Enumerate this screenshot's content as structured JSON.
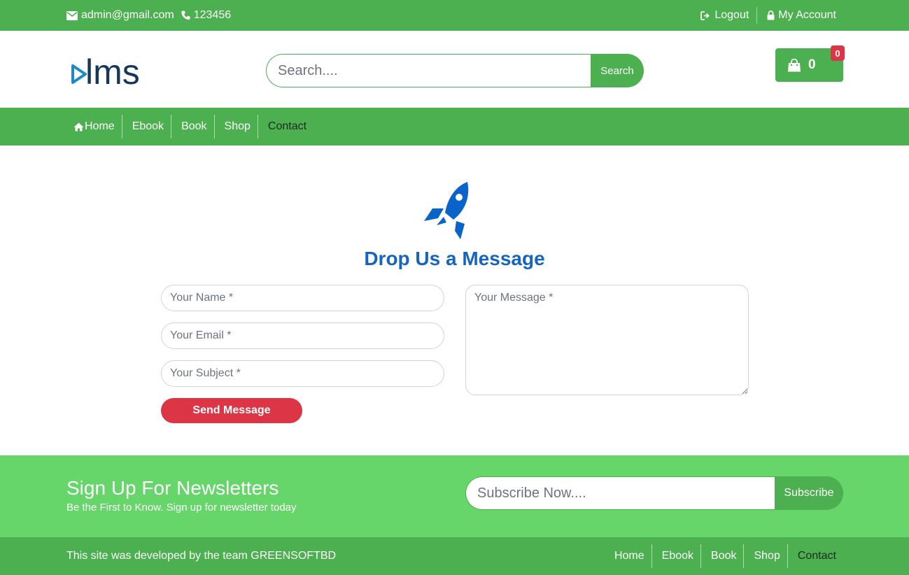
{
  "topbar": {
    "email": "admin@gmail.com",
    "phone": "123456",
    "logout": "Logout",
    "account": "My Account"
  },
  "header": {
    "logo_text": "lms",
    "search_placeholder": "Search....",
    "search_button": "Search",
    "cart_count": "0",
    "cart_badge": "0"
  },
  "nav": {
    "items": [
      "Home",
      "Ebook",
      "Book",
      "Shop",
      "Contact"
    ],
    "active": "Contact"
  },
  "contact": {
    "title": "Drop Us a Message",
    "name_placeholder": "Your Name *",
    "email_placeholder": "Your Email *",
    "subject_placeholder": "Your Subject *",
    "message_placeholder": "Your Message *",
    "send_button": "Send Message"
  },
  "newsletter": {
    "title": "Sign Up For Newsletters",
    "subtitle": "Be the First to Know. Sign up for newsletter today",
    "input_placeholder": "Subscribe Now....",
    "button": "Subscribe"
  },
  "footer": {
    "credit": "This site was developed by the team GREENSOFTBD",
    "links": [
      "Home",
      "Ebook",
      "Book",
      "Shop",
      "Contact"
    ],
    "active": "Contact"
  },
  "colors": {
    "primary_green": "#4caf50",
    "newsletter_green": "#66d66a",
    "accent_blue": "#1565c0",
    "danger_red": "#dc3545"
  },
  "icons": [
    "envelope-icon",
    "phone-icon",
    "sign-out-icon",
    "lock-icon",
    "shopping-bag-icon",
    "home-icon",
    "rocket-icon"
  ]
}
